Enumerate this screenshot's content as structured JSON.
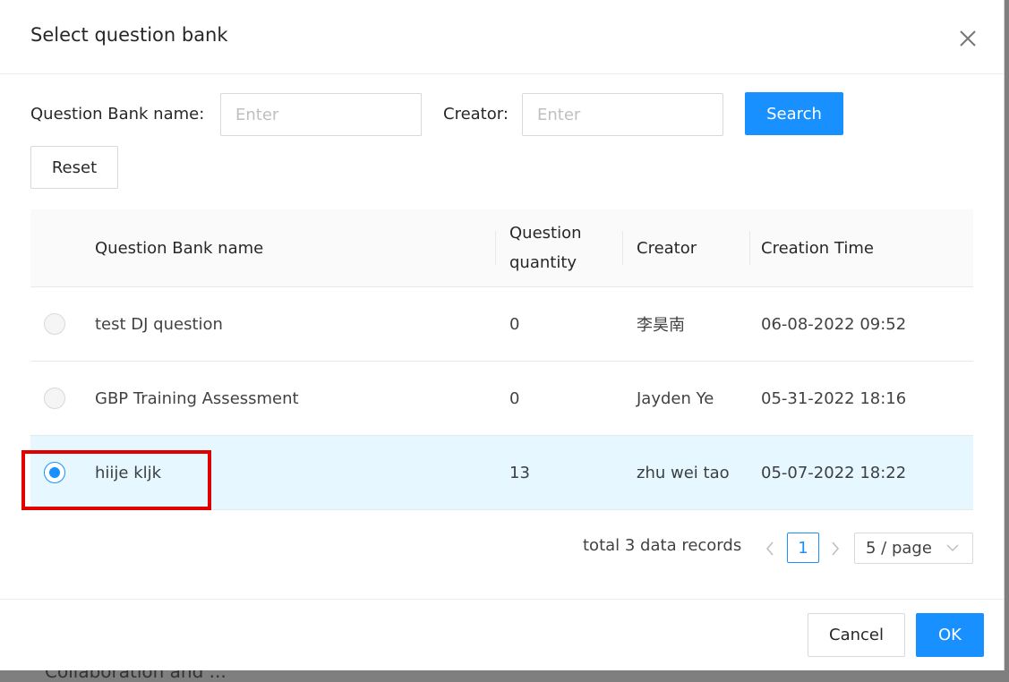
{
  "background_text": "Collaboration and ...",
  "modal": {
    "title": "Select question bank"
  },
  "filters": {
    "bank_name_label": "Question Bank name:",
    "bank_name_placeholder": "Enter",
    "creator_label": "Creator:",
    "creator_placeholder": "Enter",
    "search_label": "Search",
    "reset_label": "Reset"
  },
  "table": {
    "headers": {
      "name": "Question Bank name",
      "quantity_line1": "Question",
      "quantity_line2": "quantity",
      "creator": "Creator",
      "time": "Creation Time"
    },
    "rows": [
      {
        "name": "test DJ question",
        "quantity": "0",
        "creator": "李昊南",
        "time": "06-08-2022 09:52",
        "selected": false
      },
      {
        "name": "GBP Training Assessment",
        "quantity": "0",
        "creator": "Jayden Ye",
        "time": "05-31-2022 18:16",
        "selected": false
      },
      {
        "name": "hiije kljk",
        "quantity": "13",
        "creator": "zhu wei tao",
        "time": "05-07-2022 18:22",
        "selected": true
      }
    ]
  },
  "pagination": {
    "total": "total 3 data records",
    "current_page": "1",
    "page_size": "5 / page"
  },
  "footer": {
    "cancel_label": "Cancel",
    "ok_label": "OK"
  },
  "colors": {
    "primary": "#1890ff",
    "selected_row": "#e6f7ff",
    "annotation_red": "#e00000"
  }
}
